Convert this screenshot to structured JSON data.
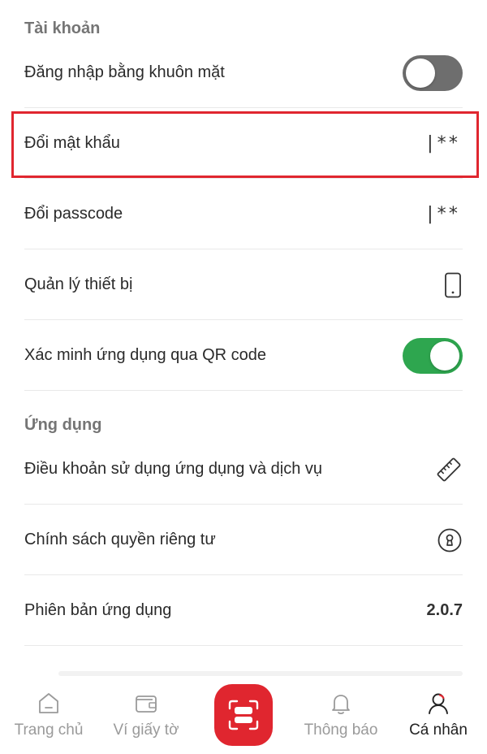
{
  "sections": {
    "account_title": "Tài khoản",
    "app_title": "Ứng dụng"
  },
  "rows": {
    "face_login": {
      "label": "Đăng nhập bằng khuôn mặt",
      "enabled": false
    },
    "change_password": {
      "label": "Đổi mật khẩu",
      "value": "|**"
    },
    "change_passcode": {
      "label": "Đổi passcode",
      "value": "|**"
    },
    "device_management": {
      "label": "Quản lý thiết bị",
      "icon": "phone-icon"
    },
    "qr_verify": {
      "label": "Xác minh ứng dụng qua QR code",
      "enabled": true
    },
    "terms": {
      "label": "Điều khoản sử dụng ứng dụng và dịch vụ",
      "icon": "ruler-icon"
    },
    "privacy": {
      "label": "Chính sách quyền riêng tư",
      "icon": "keyhole-icon"
    },
    "app_version": {
      "label": "Phiên bản ứng dụng",
      "value": "2.0.7"
    }
  },
  "nav": {
    "home": {
      "label": "Trang chủ",
      "icon": "home-icon"
    },
    "wallet": {
      "label": "Ví giấy tờ",
      "icon": "wallet-icon"
    },
    "scan": {
      "icon": "scan-icon"
    },
    "notifications": {
      "label": "Thông báo",
      "icon": "bell-icon"
    },
    "profile": {
      "label": "Cá nhân",
      "icon": "user-icon",
      "active": true
    }
  },
  "colors": {
    "accent": "#e0262f",
    "toggle_on": "#2ea64f",
    "toggle_off": "#6e6e6e",
    "highlight": "#e0262f"
  }
}
